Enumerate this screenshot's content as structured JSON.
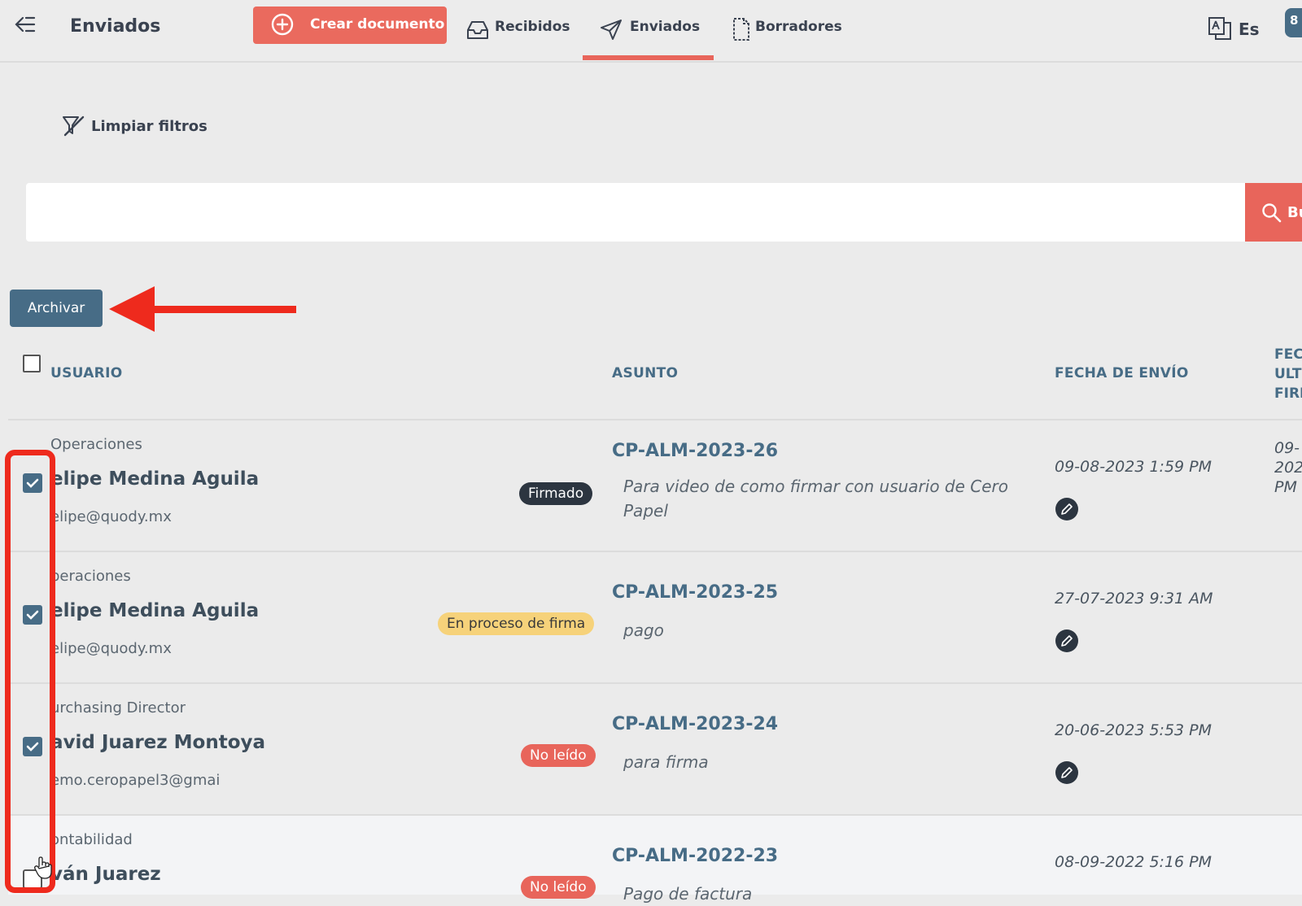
{
  "header": {
    "title": "Enviados",
    "create_label": "Crear documento",
    "tabs": [
      {
        "label": "Recibidos",
        "icon": "inbox-icon"
      },
      {
        "label": "Enviados",
        "icon": "send-icon",
        "active": true
      },
      {
        "label": "Borradores",
        "icon": "draft-icon"
      }
    ],
    "language": "Es",
    "notification_count": "8"
  },
  "filters": {
    "clear_label": "Limpiar filtros"
  },
  "search": {
    "value": "",
    "button_label": "Bu"
  },
  "actions": {
    "archive_label": "Archivar"
  },
  "table": {
    "columns": {
      "usuario": "USUARIO",
      "asunto": "ASUNTO",
      "fecha_envio": "FECHA DE ENVÍO",
      "extra_lines": [
        "FEC",
        "ULT",
        "FIRI"
      ]
    },
    "rows": [
      {
        "dept": "Operaciones",
        "name": "elipe Medina Aguila",
        "email": "elipe@quody.mx",
        "status": "Firmado",
        "code": "CP-ALM-2023-26",
        "subject": "Para video de como firmar con usuario de Cero Papel",
        "date": "09-08-2023 1:59 PM",
        "last_lines": [
          "09-",
          "202",
          "PM"
        ],
        "checked": true
      },
      {
        "dept": "peraciones",
        "name": "elipe Medina Aguila",
        "email": "elipe@quody.mx",
        "status": "En proceso de firma",
        "code": "CP-ALM-2023-25",
        "subject": "pago",
        "date": "27-07-2023 9:31 AM",
        "checked": true
      },
      {
        "dept": "urchasing Director",
        "name": "avid Juarez Montoya",
        "email": "emo.ceropapel3@gmai",
        "status": "No leído",
        "code": "CP-ALM-2023-24",
        "subject": "para firma",
        "date": "20-06-2023 5:53 PM",
        "checked": true
      },
      {
        "dept": "ontabilidad",
        "name": "ván Juarez",
        "status": "No leído",
        "code": "CP-ALM-2022-23",
        "subject": "Pago de factura",
        "date": "08-09-2022 5:16 PM",
        "checked": false
      }
    ]
  },
  "colors": {
    "accent": "#e8655b",
    "primary": "#476c86",
    "annotation": "#ee2a1d"
  }
}
